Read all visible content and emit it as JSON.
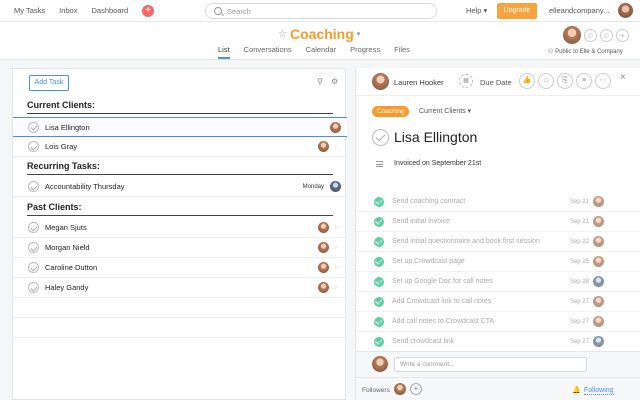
{
  "topbar": {
    "nav": [
      "My Tasks",
      "Inbox",
      "Dashboard"
    ],
    "search_placeholder": "Search",
    "help": "Help",
    "upgrade": "Upgrade",
    "org": "elleandcompany..."
  },
  "project": {
    "name": "Coaching",
    "tabs": [
      "List",
      "Conversations",
      "Calendar",
      "Progress",
      "Files"
    ],
    "public_label": "Public to Elle & Company"
  },
  "list": {
    "add_task": "Add Task",
    "sections": [
      {
        "name": "Current Clients:",
        "tasks": [
          {
            "name": "Lisa Ellington",
            "due": ""
          },
          {
            "name": "Lois Gray",
            "due": ""
          }
        ]
      },
      {
        "name": "Recurring Tasks:",
        "tasks": [
          {
            "name": "Accountability Thursday",
            "due": "Monday"
          }
        ]
      },
      {
        "name": "Past Clients:",
        "tasks": [
          {
            "name": "Megan Sjuts",
            "due": ""
          },
          {
            "name": "Morgan Nield",
            "due": ""
          },
          {
            "name": "Caroline Dutton",
            "due": ""
          },
          {
            "name": "Haley Gandy",
            "due": ""
          }
        ]
      }
    ]
  },
  "detail": {
    "assignee": "Lauren Hooker",
    "due_label": "Due Date",
    "tag": "Coaching",
    "section": "Current Clients",
    "title": "Lisa Ellington",
    "description": "Invoiced on September 21st",
    "subtasks": [
      {
        "name": "Send coaching contract",
        "date": "Sep 21"
      },
      {
        "name": "Send initial invoice",
        "date": "Sep 21"
      },
      {
        "name": "Send initial questionnaire and book first session",
        "date": "Sep 22"
      },
      {
        "name": "Set up Crowdcast page",
        "date": "Sep 25"
      },
      {
        "name": "Set up Google Doc for call notes",
        "date": "Sep 28"
      },
      {
        "name": "Add Crowdcast link to call notes",
        "date": "Sep 27"
      },
      {
        "name": "Add call notes to Crowdcast CTA",
        "date": "Sep 27"
      },
      {
        "name": "Send crowdcast link",
        "date": "Sep 27"
      }
    ],
    "comment_placeholder": "Write a comment...",
    "followers_label": "Followers",
    "following_label": "Following"
  }
}
